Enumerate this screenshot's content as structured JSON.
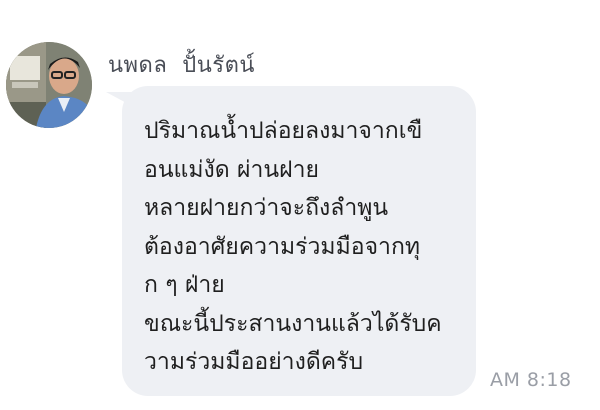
{
  "message": {
    "sender_name": "นพดล  ปั้นรัตน์",
    "lines": [
      "ปริมาณน้ำปล่อยลงมาจากเขื",
      "อนแม่งัด ผ่านฝาย",
      "หลายฝายกว่าจะถึงลำพูน",
      "ต้องอาศัยความร่วมมือจากทุ",
      "ก ๆ ฝ่าย",
      "ขณะนี้ประสานงานแล้วได้รับค",
      "วามร่วมมืออย่างดีครับ"
    ],
    "time": "AM 8:18"
  },
  "avatar": {
    "icon": "profile-photo-icon"
  }
}
